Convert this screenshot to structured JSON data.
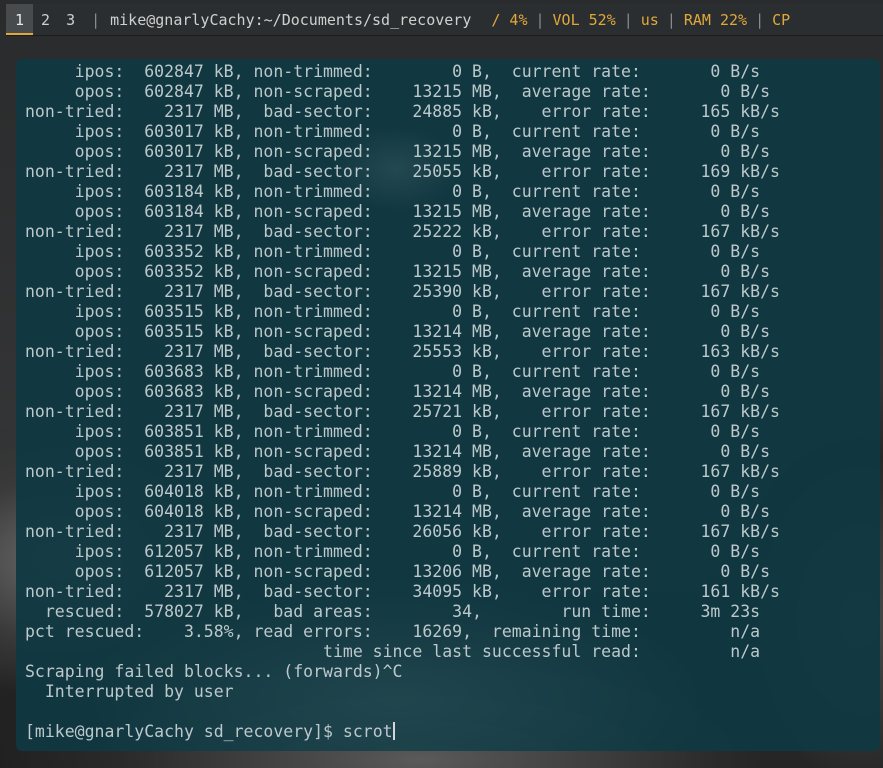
{
  "statusbar": {
    "workspaces": [
      {
        "label": "1",
        "active": true
      },
      {
        "label": "2",
        "active": false
      },
      {
        "label": "3",
        "active": false
      }
    ],
    "window_title": "mike@gnarlyCachy:~/Documents/sd_recovery",
    "separators": [
      "/",
      "|",
      "|",
      "|",
      "|"
    ],
    "progress": "4%",
    "volume": "VOL 52%",
    "keyboard_layout": "us",
    "ram": "RAM 22%",
    "cpu": "CP",
    "accent_color": "#e0a83a"
  },
  "terminal": {
    "background": "#0f3842",
    "lines": [
      "     ipos:  602847 kB, non-trimmed:        0 B,  current rate:       0 B/s",
      "     opos:  602847 kB, non-scraped:    13215 MB,  average rate:       0 B/s",
      "non-tried:    2317 MB,  bad-sector:    24885 kB,    error rate:     165 kB/s",
      "     ipos:  603017 kB, non-trimmed:        0 B,  current rate:       0 B/s",
      "     opos:  603017 kB, non-scraped:    13215 MB,  average rate:       0 B/s",
      "non-tried:    2317 MB,  bad-sector:    25055 kB,    error rate:     169 kB/s",
      "     ipos:  603184 kB, non-trimmed:        0 B,  current rate:       0 B/s",
      "     opos:  603184 kB, non-scraped:    13215 MB,  average rate:       0 B/s",
      "non-tried:    2317 MB,  bad-sector:    25222 kB,    error rate:     167 kB/s",
      "     ipos:  603352 kB, non-trimmed:        0 B,  current rate:       0 B/s",
      "     opos:  603352 kB, non-scraped:    13215 MB,  average rate:       0 B/s",
      "non-tried:    2317 MB,  bad-sector:    25390 kB,    error rate:     167 kB/s",
      "     ipos:  603515 kB, non-trimmed:        0 B,  current rate:       0 B/s",
      "     opos:  603515 kB, non-scraped:    13214 MB,  average rate:       0 B/s",
      "non-tried:    2317 MB,  bad-sector:    25553 kB,    error rate:     163 kB/s",
      "     ipos:  603683 kB, non-trimmed:        0 B,  current rate:       0 B/s",
      "     opos:  603683 kB, non-scraped:    13214 MB,  average rate:       0 B/s",
      "non-tried:    2317 MB,  bad-sector:    25721 kB,    error rate:     167 kB/s",
      "     ipos:  603851 kB, non-trimmed:        0 B,  current rate:       0 B/s",
      "     opos:  603851 kB, non-scraped:    13214 MB,  average rate:       0 B/s",
      "non-tried:    2317 MB,  bad-sector:    25889 kB,    error rate:     167 kB/s",
      "     ipos:  604018 kB, non-trimmed:        0 B,  current rate:       0 B/s",
      "     opos:  604018 kB, non-scraped:    13214 MB,  average rate:       0 B/s",
      "non-tried:    2317 MB,  bad-sector:    26056 kB,    error rate:     167 kB/s",
      "     ipos:  612057 kB, non-trimmed:        0 B,  current rate:       0 B/s",
      "     opos:  612057 kB, non-scraped:    13206 MB,  average rate:       0 B/s",
      "non-tried:    2317 MB,  bad-sector:    34095 kB,    error rate:     161 kB/s",
      "  rescued:  578027 kB,   bad areas:        34,        run time:     3m 23s",
      "pct rescued:    3.58%, read errors:    16269,  remaining time:         n/a",
      "                              time since last successful read:         n/a",
      "Scraping failed blocks... (forwards)^C",
      "  Interrupted by user",
      ""
    ],
    "prompt": "[mike@gnarlyCachy sd_recovery]$ ",
    "command": "scrot"
  }
}
